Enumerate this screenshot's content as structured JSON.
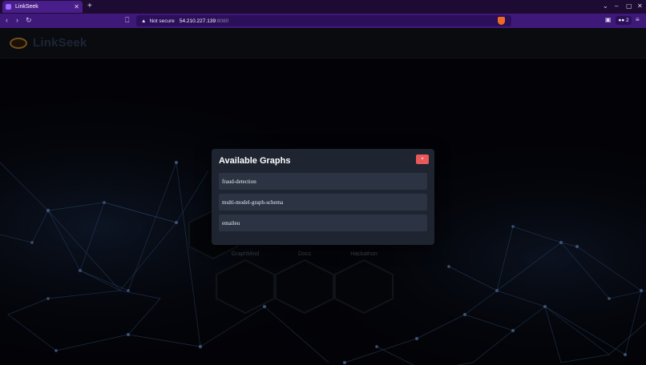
{
  "browser": {
    "tab_title": "LinkSeek",
    "tab_close": "✕",
    "new_tab": "+",
    "security_label": "Not secure",
    "url_host": "54.210.227.139",
    "url_port": ":8080",
    "extension_badge": "2",
    "icons": {
      "back": "chevron-left-icon",
      "forward": "chevron-right-icon",
      "reload": "reload-icon",
      "bookmark": "bookmark-icon",
      "warning": "warning-icon",
      "shield": "brave-shield-icon",
      "sidebar": "sidebar-icon",
      "menu": "menu-icon"
    }
  },
  "app": {
    "brand": "LinkSeek",
    "hex_tiles": [
      "GraphMind",
      "Docs",
      "Hackathon"
    ]
  },
  "modal": {
    "title": "Available Graphs",
    "close_label": "×",
    "graphs": [
      "fraud-detection",
      "multi-model-graph-schema",
      "emaileu"
    ]
  },
  "colors": {
    "tab_active": "#4a1e8a",
    "addressbar": "#3f197a",
    "modal_bg": "#1e2430",
    "list_item_bg": "#2c3444",
    "close_button": "#e8595a",
    "brand_text": "#2c3a55"
  }
}
